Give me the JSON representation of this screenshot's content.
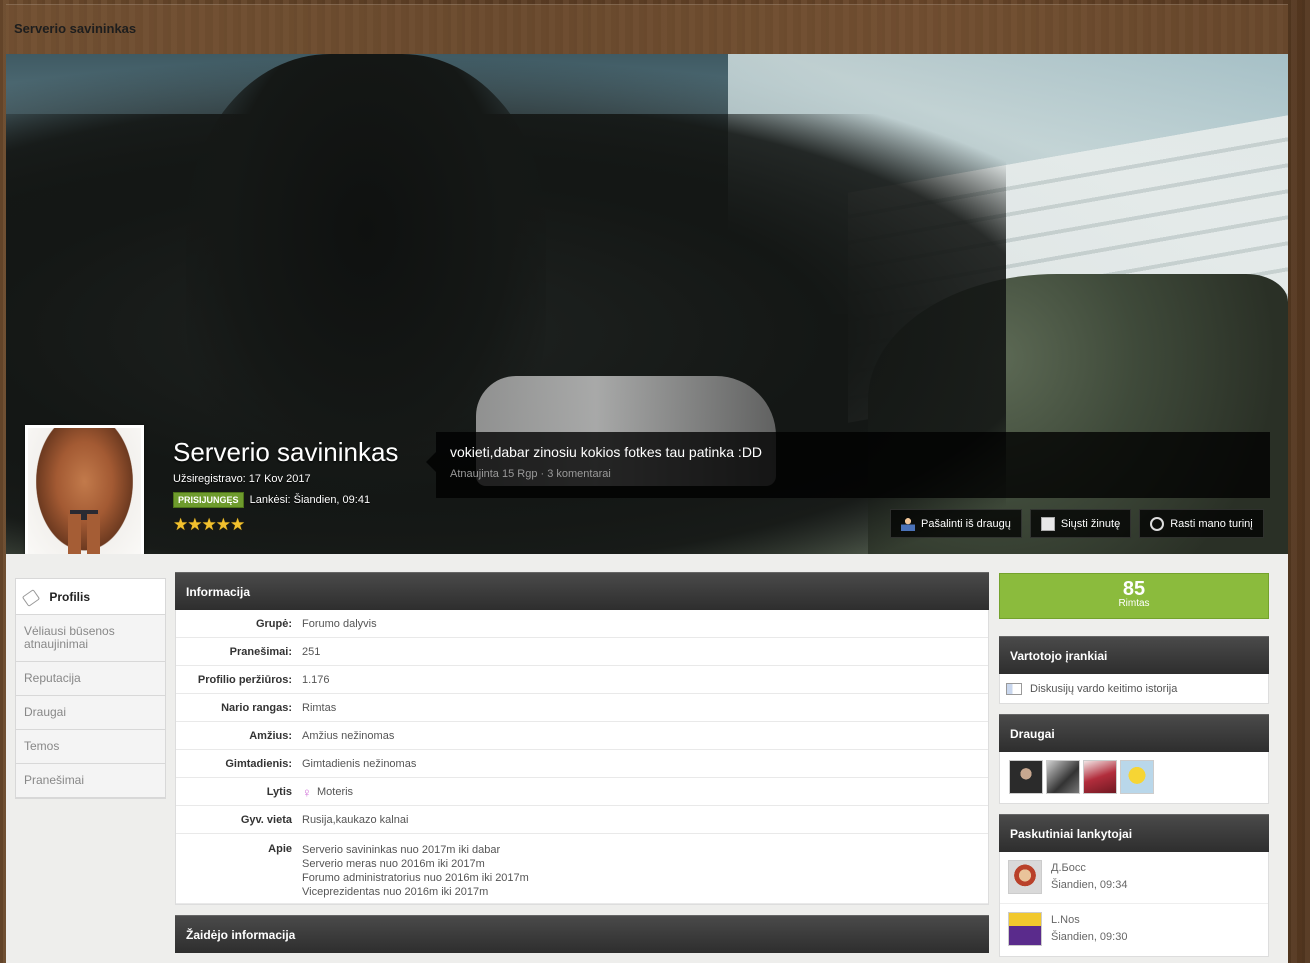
{
  "page": {
    "header_title": "Serverio savininkas"
  },
  "profile": {
    "name": "Serverio savininkas",
    "joined": "Užsiregistravo: 17 Kov 2017",
    "online_badge": "PRISIJUNGĘS",
    "last_visit": "Lankėsi: Šiandien, 09:41",
    "stars": "★★★★★",
    "rating_stars": 5
  },
  "status": {
    "text": "vokieti,dabar zinosiu kokios fotkes tau patinka :DD",
    "meta": "Atnaujinta 15 Rgp · 3 komentarai"
  },
  "cover_buttons": {
    "remove_friend": "Pašalinti iš draugų",
    "send_message": "Siųsti žinutę",
    "find_content": "Rasti mano turinį"
  },
  "sidebar": {
    "items": [
      "Profilis",
      "Vėliausi būsenos atnaujinimai",
      "Reputacija",
      "Draugai",
      "Temos",
      "Pranešimai"
    ]
  },
  "info": {
    "title": "Informacija",
    "rows": [
      {
        "label": "Grupė:",
        "value": "Forumo dalyvis"
      },
      {
        "label": "Pranešimai:",
        "value": "251"
      },
      {
        "label": "Profilio peržiūros:",
        "value": "1.176"
      },
      {
        "label": "Nario rangas:",
        "value": "Rimtas"
      },
      {
        "label": "Amžius:",
        "value": "Amžius nežinomas"
      },
      {
        "label": "Gimtadienis:",
        "value": "Gimtadienis nežinomas"
      },
      {
        "label": "Lytis",
        "value": "Moteris"
      },
      {
        "label": "Gyv. vieta",
        "value": "Rusija,kaukazo kalnai"
      }
    ],
    "about_label": "Apie",
    "about_lines": [
      "Serverio savininkas nuo 2017m iki dabar",
      "Serverio meras nuo 2016m iki 2017m",
      "Forumo administratorius nuo 2016m iki 2017m",
      "Viceprezidentas nuo 2016m iki 2017m"
    ]
  },
  "game_info": {
    "title": "Žaidėjo informacija"
  },
  "reputation": {
    "value": "85",
    "label": "Rimtas"
  },
  "user_tools": {
    "title": "Vartotojo įrankiai",
    "item": "Diskusijų vardo keitimo istorija"
  },
  "friends": {
    "title": "Draugai"
  },
  "visitors": {
    "title": "Paskutiniai lankytojai",
    "items": [
      {
        "name": "Д.Босс",
        "time": "Šiandien, 09:34"
      },
      {
        "name": "L.Nos",
        "time": "Šiandien, 09:30"
      }
    ]
  }
}
